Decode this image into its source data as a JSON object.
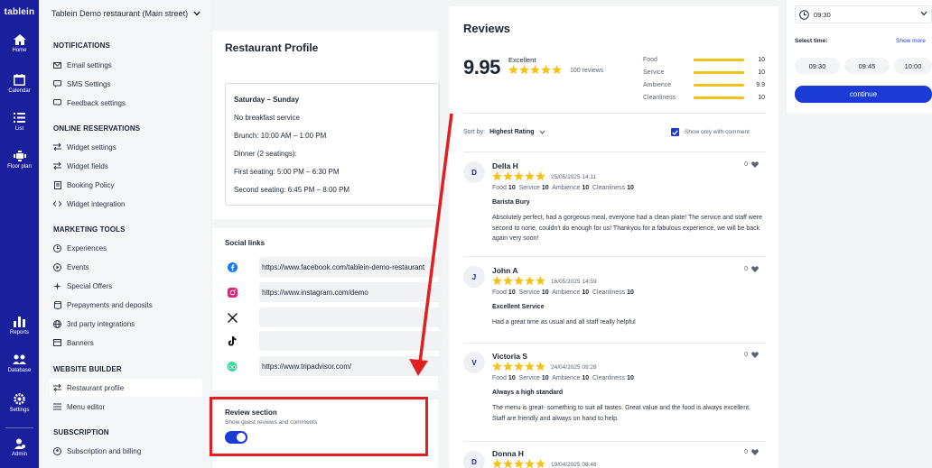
{
  "app": {
    "logo": "tablein"
  },
  "rail": {
    "items": [
      {
        "label": "Home",
        "icon": "home-icon"
      },
      {
        "label": "Calendar",
        "icon": "calendar-icon"
      },
      {
        "label": "List",
        "icon": "list-icon"
      },
      {
        "label": "Floor plan",
        "icon": "floor-plan-icon"
      },
      {
        "label": "Reports",
        "icon": "reports-icon"
      },
      {
        "label": "Database",
        "icon": "database-icon"
      },
      {
        "label": "Settings",
        "icon": "settings-icon"
      },
      {
        "label": "Admin",
        "icon": "admin-icon"
      }
    ]
  },
  "header": {
    "restaurant": "Tablein Demo restaurant (Main street)"
  },
  "menu": {
    "notifications": "NOTIFICATIONS",
    "email_settings": "Email settings",
    "sms_settings": "SMS Settings",
    "feedback_settings": "Feedback settings",
    "online_reservations": "ONLINE RESERVATIONS",
    "widget_settings": "Widget settings",
    "widget_fields": "Widget fields",
    "booking_policy": "Booking Policy",
    "widget_integration": "Widget integration",
    "marketing_tools": "MARKETING TOOLS",
    "experiences": "Experiences",
    "events": "Events",
    "special_offers": "Special Offers",
    "prepayments": "Prepayments and deposits",
    "third_party": "3rd party integrations",
    "banners": "Banners",
    "website_builder": "WEBSITE BUILDER",
    "restaurant_profile": "Restaurant profile",
    "menu_editor": "Menu editor",
    "subscription": "SUBSCRIPTION",
    "subscription_billing": "Subscription and billing"
  },
  "profile": {
    "title": "Restaurant Profile",
    "hours": {
      "heading": "Saturday – Sunday",
      "l1": "No breakfast service",
      "l2": "Brunch: 10:00 AM – 1:00 PM",
      "l3": "Dinner (2 seatings):",
      "l4": "First seating: 5:00 PM – 6:30 PM",
      "l5": "Second seating: 6:45 PM – 8:00 PM"
    },
    "social_title": "Social links",
    "facebook": "https://www.facebook.com/tablein-demo-restaurant",
    "instagram": "https://www.instagram.com/demo",
    "x": "",
    "tiktok": "",
    "tripadvisor": "https://www.tripadvisor.com/",
    "review_section_title": "Review section",
    "review_section_sub": "Show guest reviews and comments",
    "review_toggle_on": true
  },
  "reviews": {
    "title": "Reviews",
    "score": "9.95",
    "score_label": "Excellent",
    "count": "100 reviews",
    "categories": [
      {
        "name": "Food",
        "value": "10"
      },
      {
        "name": "Service",
        "value": "10"
      },
      {
        "name": "Ambience",
        "value": "9.9"
      },
      {
        "name": "Cleanliness",
        "value": "10"
      }
    ],
    "sort_label": "Sort by:",
    "sort_value": "Highest Rating",
    "only_comment": "Show only with comment",
    "score_labels": {
      "food": "Food",
      "service": "Service",
      "ambience": "Ambience",
      "cleanliness": "Cleanliness"
    },
    "items": [
      {
        "initial": "D",
        "name": "Della H",
        "date": "25/05/2025 14:11",
        "likes": "0",
        "food": "10",
        "service": "10",
        "ambience": "10",
        "cleanliness": "10",
        "title": "Barista Bury",
        "text": "Absolutely perfect, had a gorgeous meal, everyone had a clean plate! The service and staff were second to none, couldn't do enough for us! Thankyou for a fabulous experience, we will be back again very soon!"
      },
      {
        "initial": "J",
        "name": "John A",
        "date": "16/05/2025 14:59",
        "likes": "0",
        "food": "10",
        "service": "10",
        "ambience": "10",
        "cleanliness": "10",
        "title": "Excellent Service",
        "text": "Had a great time as usual and all staff really helpful"
      },
      {
        "initial": "V",
        "name": "Victoria S",
        "date": "24/04/2025 09:28",
        "likes": "0",
        "food": "10",
        "service": "10",
        "ambience": "10",
        "cleanliness": "10",
        "title": "Always a high standard",
        "text": "The menu is great- something to suit all tastes. Great value and the food is always excellent. Staff are friendly and always on hand to help."
      },
      {
        "initial": "D",
        "name": "Donna H",
        "date": "19/04/2025 08:48",
        "likes": "0"
      }
    ]
  },
  "widget": {
    "selected_time": "09:30",
    "select_time": "Select time:",
    "show_more": "Show more",
    "slots": [
      "09:30",
      "09:45",
      "10:00"
    ],
    "continue": "continue"
  },
  "colors": {
    "brand": "#1a1f9c",
    "accent": "#1a3bd6",
    "star": "#f2c21a",
    "highlight": "#e02020"
  }
}
